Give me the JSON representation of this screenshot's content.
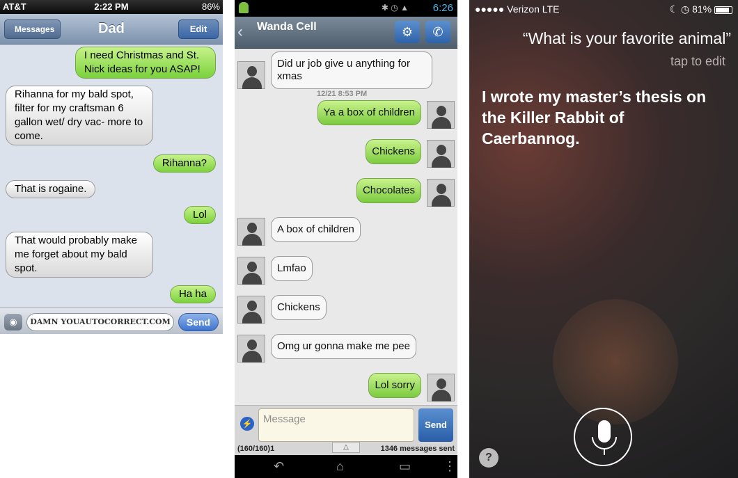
{
  "ios": {
    "status": {
      "carrier": "AT&T",
      "time": "2:22 PM",
      "battery": "86%"
    },
    "nav": {
      "back": "Messages",
      "title": "Dad",
      "edit": "Edit"
    },
    "messages": [
      {
        "dir": "out",
        "text": "I need Christmas and St. Nick ideas for you ASAP!"
      },
      {
        "dir": "in",
        "text": "Rihanna for my bald spot, filter for my craftsman 6 gallon wet/ dry vac- more to come."
      },
      {
        "dir": "out",
        "text": "Rihanna?"
      },
      {
        "dir": "in",
        "text": "That is rogaine."
      },
      {
        "dir": "out",
        "text": "Lol"
      },
      {
        "dir": "in",
        "text": "That would probably make me forget about my bald spot."
      },
      {
        "dir": "out",
        "text": "Ha ha"
      }
    ],
    "input_text": "DAMN YOUAUTOCORRECT.COM",
    "send": "Send"
  },
  "android": {
    "status": {
      "time": "6:26"
    },
    "header": {
      "title": "Wanda Cell"
    },
    "messages": [
      {
        "dir": "in",
        "text": "Did ur job give u anything for xmas"
      },
      {
        "dir": "out",
        "text": "Ya a box of children"
      },
      {
        "dir": "out",
        "text": "Chickens"
      },
      {
        "dir": "out",
        "text": "Chocolates"
      },
      {
        "dir": "in",
        "text": "A box of children"
      },
      {
        "dir": "in",
        "text": "Lmfao"
      },
      {
        "dir": "in",
        "text": "Chickens"
      },
      {
        "dir": "in",
        "text": "Omg ur gonna make me pee"
      },
      {
        "dir": "out",
        "text": "Lol sorry"
      }
    ],
    "timestamp": "12/21 8:53 PM",
    "placeholder": "Message",
    "send": "Send",
    "counter": "(160/160)1",
    "messages_sent": "1346 messages sent"
  },
  "siri": {
    "status": {
      "carrier": "Verizon",
      "network": "LTE",
      "battery": "81%"
    },
    "query": "“What is your favorite animal”",
    "tap_to_edit": "tap to edit",
    "answer": "I wrote my master’s thesis on the Killer Rabbit of Caerbannog."
  }
}
